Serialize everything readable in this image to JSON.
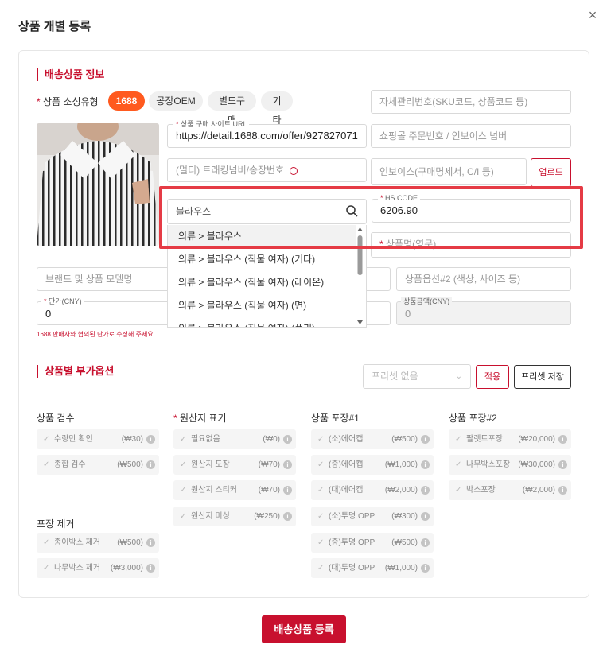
{
  "modal": {
    "title": "상품 개별 등록",
    "close_icon": "×"
  },
  "section1": {
    "title": "배송상품 정보",
    "sourcing": {
      "label": "상품 소싱유형",
      "options": [
        "1688",
        "공장OEM",
        "별도구매",
        "기타"
      ],
      "selected": "1688"
    },
    "sku_input": {
      "placeholder": "자체관리번호(SKU코드, 상품코드 등)"
    },
    "purchase_url": {
      "label": "상품 구매 사이트 URL",
      "value": "https://detail.1688.com/offer/927827071"
    },
    "order_no": {
      "placeholder": "쇼핑몰 주문번호 / 인보이스 넘버"
    },
    "tracking": {
      "placeholder": "(멀티) 트래킹넘버/송장번호"
    },
    "invoice": {
      "placeholder": "인보이스(구매명세서, C/I 등)"
    },
    "upload_label": "업로드",
    "hs_search": {
      "value": "블라우스"
    },
    "hs_code": {
      "label": "HS CODE",
      "value": "6206.90"
    },
    "dropdown_items": [
      "의류 > 블라우스",
      "의류 > 블라우스 (직물 여자) (기타)",
      "의류 > 블라우스 (직물 여자) (레이온)",
      "의류 > 블라우스 (직물 여자) (면)",
      "의류 > 블라우스 (직물 여자) (폴리)"
    ],
    "product_name_en": {
      "label": "상품명(영문)"
    },
    "brand": {
      "placeholder": "브랜드 및 상품 모델명"
    },
    "option2": {
      "placeholder": "상품옵션#2 (색상, 사이즈 등)"
    },
    "unit_price": {
      "label": "단가(CNY)",
      "value": "0"
    },
    "total_price": {
      "label": "상품금액(CNY)",
      "value": "0"
    },
    "price_hint": "1688 판매사와 협의된 단가로 수정해 주세요."
  },
  "section2": {
    "title": "상품별 부가옵션",
    "preset_select": {
      "value": "프리셋 없음"
    },
    "apply_label": "적용",
    "save_preset_label": "프리셋 저장",
    "groups": {
      "inspection": {
        "title": "상품 검수",
        "items": [
          {
            "name": "수량만 확인",
            "price": "(₩30)"
          },
          {
            "name": "종합 검수",
            "price": "(₩500)"
          }
        ]
      },
      "origin": {
        "title": "원산지 표기",
        "items": [
          {
            "name": "필요없음",
            "price": "(₩0)"
          },
          {
            "name": "원산지 도장",
            "price": "(₩70)"
          },
          {
            "name": "원산지 스티커",
            "price": "(₩70)"
          },
          {
            "name": "원산지 미싱",
            "price": "(₩250)"
          }
        ]
      },
      "pack1": {
        "title": "상품 포장#1",
        "items": [
          {
            "name": "(소)에어캡",
            "price": "(₩500)"
          },
          {
            "name": "(중)에어캡",
            "price": "(₩1,000)"
          },
          {
            "name": "(대)에어캡",
            "price": "(₩2,000)"
          },
          {
            "name": "(소)투명 OPP",
            "price": "(₩300)"
          },
          {
            "name": "(중)투명 OPP",
            "price": "(₩500)"
          },
          {
            "name": "(대)투명 OPP",
            "price": "(₩1,000)"
          }
        ]
      },
      "pack2": {
        "title": "상품 포장#2",
        "items": [
          {
            "name": "팔렛트포장",
            "price": "(₩20,000)"
          },
          {
            "name": "나무박스포장",
            "price": "(₩30,000)"
          },
          {
            "name": "박스포장",
            "price": "(₩2,000)"
          }
        ]
      },
      "remove": {
        "title": "포장 제거",
        "items": [
          {
            "name": "종이박스 제거",
            "price": "(₩500)"
          },
          {
            "name": "나무박스 제거",
            "price": "(₩3,000)"
          }
        ]
      }
    }
  },
  "submit_label": "배송상품 등록",
  "colors": {
    "brand_red": "#c8102e",
    "active_orange": "#ff5a1f",
    "highlight_red": "#e53b45"
  },
  "icons": {
    "search": "search-icon",
    "info": "info-icon",
    "check": "check-icon",
    "chevron": "chevron-down-icon"
  }
}
